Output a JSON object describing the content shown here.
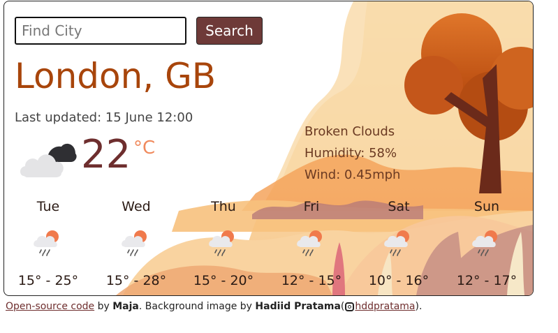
{
  "search": {
    "placeholder": "Find City",
    "button_label": "Search"
  },
  "city": "London, GB",
  "last_updated": "Last updated: 15 June 12:00",
  "current": {
    "icon": "broken-clouds-icon",
    "temperature": "22",
    "unit": "°C",
    "description": "Broken Clouds",
    "humidity": "Humidity: 58%",
    "wind": "Wind: 0.45mph"
  },
  "forecast": [
    {
      "day": "Tue",
      "range": "15° - 25°",
      "icon": "rain-sun-cloud-icon"
    },
    {
      "day": "Wed",
      "range": "15° - 28°",
      "icon": "rain-sun-cloud-icon"
    },
    {
      "day": "Thu",
      "range": "15° - 20°",
      "icon": "rain-sun-cloud-icon"
    },
    {
      "day": "Fri",
      "range": "12° - 15°",
      "icon": "rain-sun-cloud-icon"
    },
    {
      "day": "Sat",
      "range": "10° - 16°",
      "icon": "rain-sun-cloud-icon"
    },
    {
      "day": "Sun",
      "range": "12° - 17°",
      "icon": "rain-sun-cloud-icon"
    }
  ],
  "footer": {
    "code_link": "Open-source code",
    "by1": " by ",
    "author": "Maja",
    "mid": ". Background image by ",
    "artist": "Hadiid Pratama",
    "open_paren": "(",
    "handle": "hddpratama",
    "close": ")."
  },
  "colors": {
    "accent": "#a8450b",
    "button": "#6e3a38",
    "temp": "#6e2e2e",
    "unit": "#f08a5d"
  }
}
